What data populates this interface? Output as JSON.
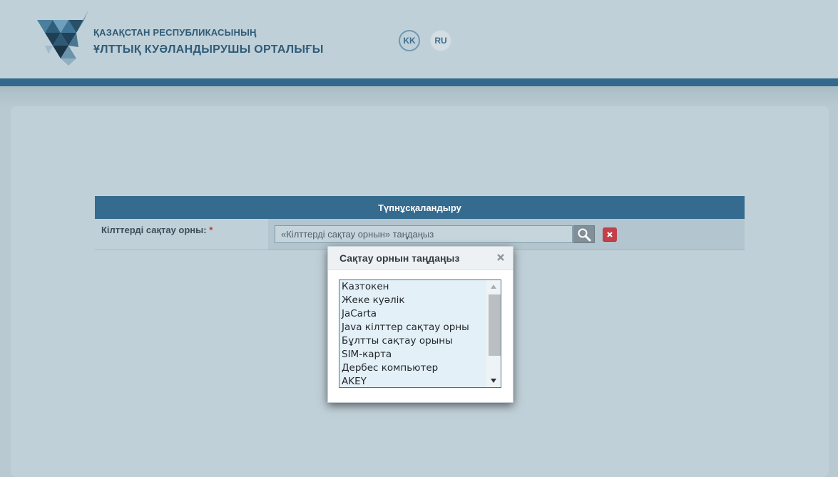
{
  "header": {
    "org_line1": "ҚАЗАҚСТАН РЕСПУБЛИКАСЫНЫҢ",
    "org_line2": "ҰЛТТЫҚ КУӘЛАНДЫРУШЫ ОРТАЛЫҒЫ",
    "logo_icon": "triangle-logo-icon",
    "languages": [
      {
        "code": "KK",
        "active": true
      },
      {
        "code": "RU",
        "active": false
      }
    ]
  },
  "form": {
    "header": "Түпнұсқаландыру",
    "key_store_label": "Кілттерді сақтау орны:",
    "required_mark": "*",
    "key_store_placeholder": "«Кілттерді сақтау орнын» таңдаңыз",
    "key_store_value": "",
    "search_icon": "magnifier-icon",
    "clear_icon": "close-x-icon"
  },
  "dialog": {
    "title": "Сақтау орнын таңдаңыз",
    "close_icon": "close-x-icon",
    "options": [
      "Казтокен",
      "Жеке куәлік",
      "JaCarta",
      "Java кілттер сақтау орны",
      "Бұлтты сақтау орыны",
      "SIM-карта",
      "Дербес компьютер",
      "AKEY"
    ]
  },
  "colors": {
    "brand_blue": "#346b8e",
    "background": "#b9c9d1",
    "danger": "#c1404a"
  }
}
